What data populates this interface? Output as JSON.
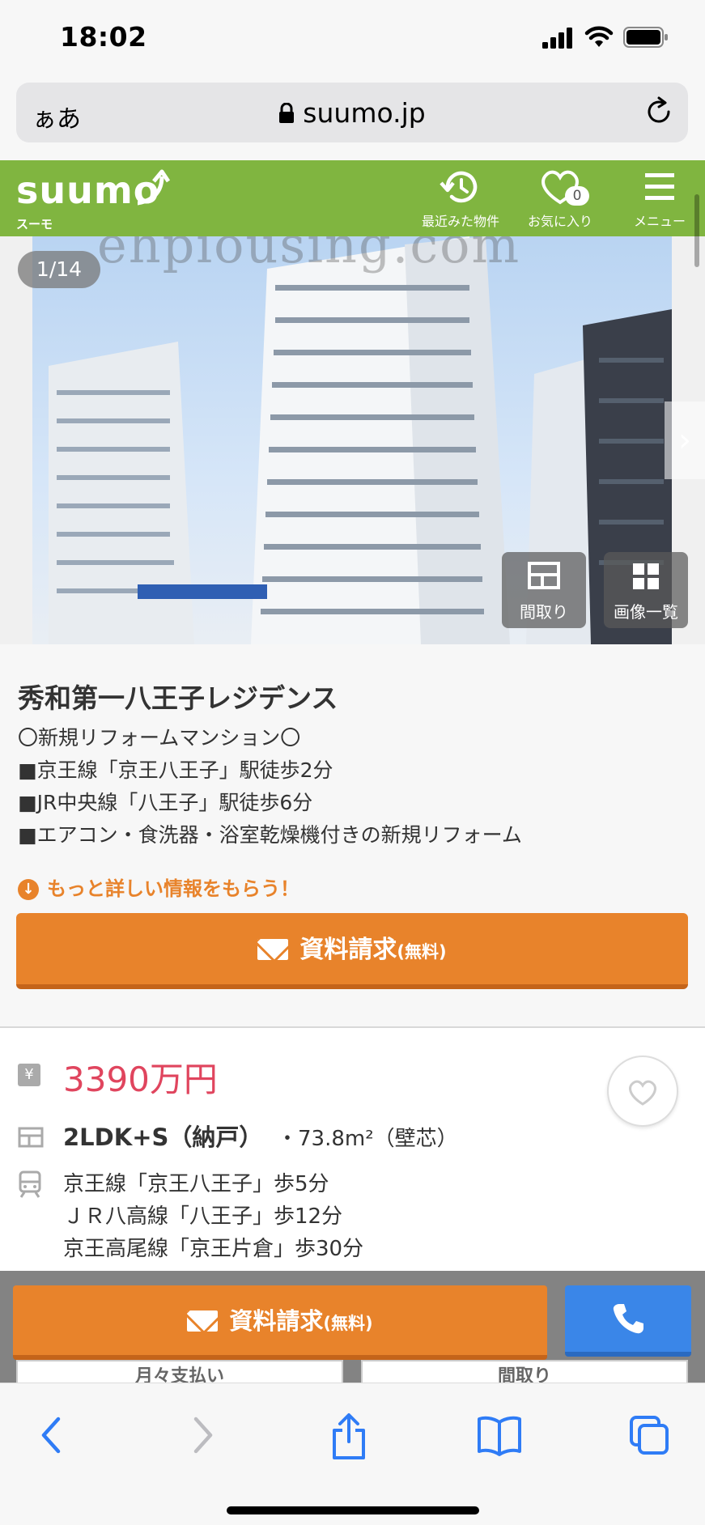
{
  "status": {
    "time": "18:02"
  },
  "browser": {
    "text_size_label": "ぁあ",
    "url": "suumo.jp"
  },
  "header": {
    "logo": "suumo",
    "logo_sub": "スーモ",
    "recent_label": "最近みた物件",
    "favorites_label": "お気に入り",
    "favorites_count": "0",
    "menu_label": "メニュー"
  },
  "photo": {
    "counter": "1/14",
    "watermark": "ehpiousing.com",
    "floorplan_label": "間取り",
    "gallery_label": "画像一覧"
  },
  "info": {
    "title": "秀和第一八王子レジデンス",
    "description": [
      "〇新規リフォームマンション〇",
      "■京王線「京王八王子」駅徒歩2分",
      "■JR中央線「八王子」駅徒歩6分",
      "■エアコン・食洗器・浴室乾燥機付きの新規リフォーム"
    ],
    "more_info": "もっと詳しい情報をもらう！",
    "request_label": "資料請求",
    "request_free": "(無料)"
  },
  "details": {
    "yen_symbol": "¥",
    "price": "3390万円",
    "layout": "2LDK+S（納戸）",
    "area": "・73.8m²（壁芯）",
    "stations": [
      "京王線「京王八王子」歩5分",
      "ＪＲ八高線「八王子」歩12分",
      "京王高尾線「京王片倉」歩30分"
    ]
  },
  "bottom_bar": {
    "request_label": "資料請求",
    "request_free": "(無料)",
    "peek_left": "月々支払い",
    "peek_right": "間取り"
  },
  "colors": {
    "suumo_green": "#80b540",
    "accent_orange": "#e8832b",
    "price_pink": "#e0455e",
    "call_blue": "#3a86e8",
    "safari_blue": "#2f7cf6"
  }
}
